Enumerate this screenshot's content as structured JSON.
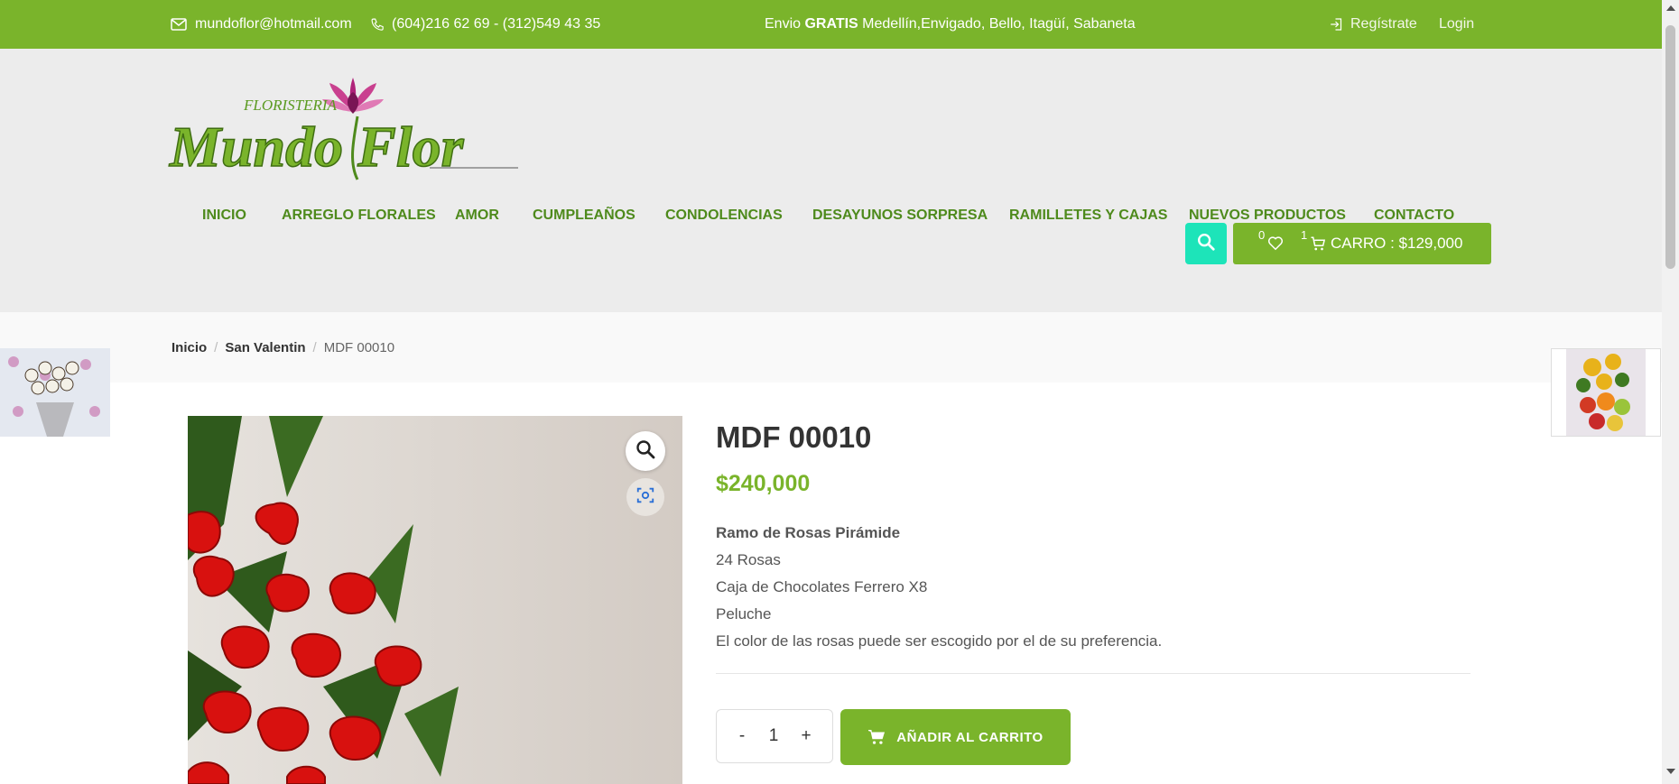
{
  "topbar": {
    "email": "mundoflor@hotmail.com",
    "phones": "(604)216 62 69 - (312)549 43 35",
    "shipping_prefix": "Envio ",
    "shipping_bold": "GRATIS",
    "shipping_rest": " Medellín,Envigado, Bello, Itagüí, Sabaneta",
    "register": "Regístrate",
    "login": "Login"
  },
  "logo": {
    "small": "FLORISTERIA",
    "main": "Mundo Flor"
  },
  "nav": [
    "INICIO",
    "ARREGLO FLORALES",
    "AMOR",
    "CUMPLEAÑOS",
    "CONDOLENCIAS",
    "DESAYUNOS SORPRESA",
    "RAMILLETES Y CAJAS",
    "NUEVOS PRODUCTOS",
    "CONTACTO"
  ],
  "cart": {
    "wishlist_count": "0",
    "cart_count": "1",
    "label": "CARRO : $129,000"
  },
  "breadcrumb": {
    "home": "Inicio",
    "category": "San Valentin",
    "current": "MDF 00010"
  },
  "product": {
    "title": "MDF 00010",
    "price": "$240,000",
    "desc_title": "Ramo de Rosas Pirámide",
    "desc_lines": [
      "24 Rosas",
      "Caja de Chocolates Ferrero X8",
      "Peluche",
      "El color de las rosas puede ser escogido por el de su preferencia."
    ],
    "qty_minus": "-",
    "qty_value": "1",
    "qty_plus": "+",
    "add_to_cart": "AÑADIR AL CARRITO"
  },
  "colors": {
    "brand_green": "#7ab42b",
    "nav_green": "#4e8a1c",
    "search_teal": "#1de4b9"
  }
}
